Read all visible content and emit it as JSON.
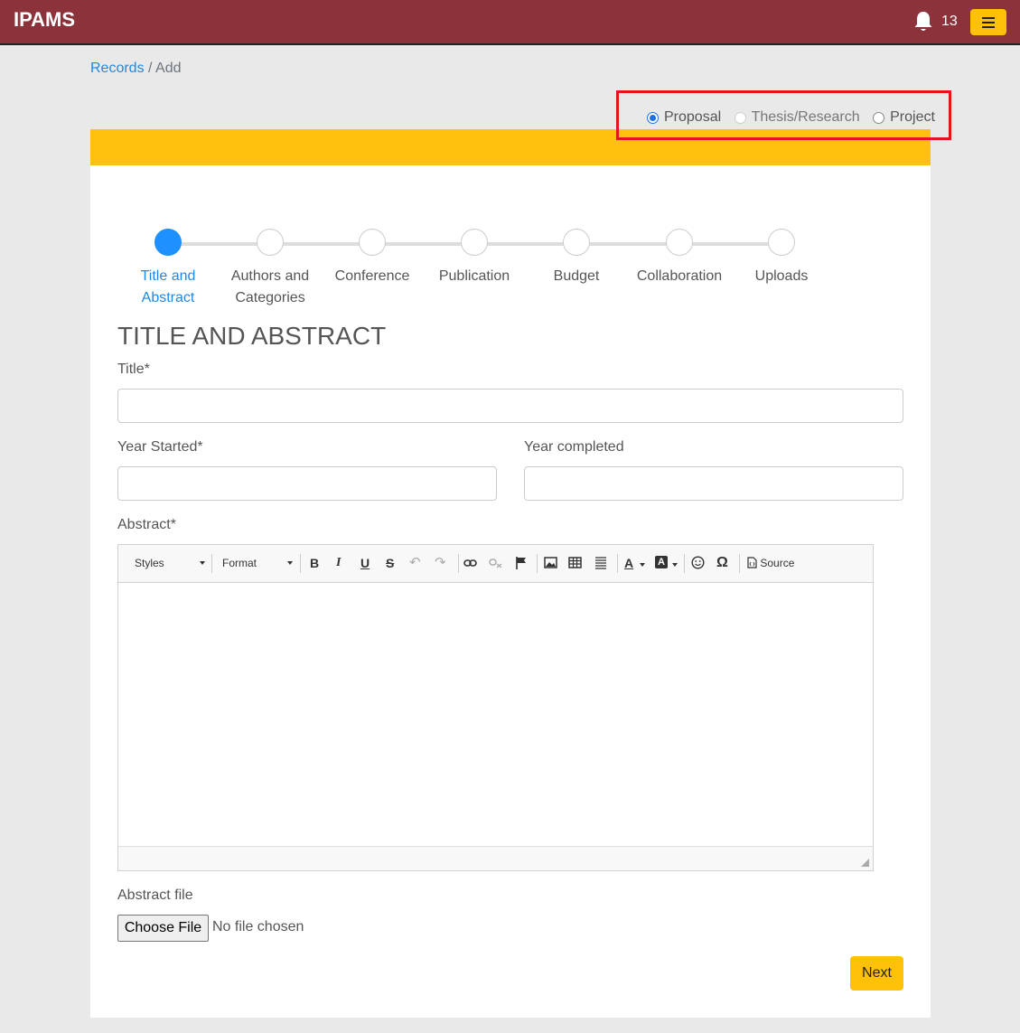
{
  "app": {
    "brand": "IPAMS",
    "notification_count": "13"
  },
  "breadcrumb": {
    "link": "Records",
    "separator": " / ",
    "current": "Add"
  },
  "record_types": [
    {
      "label": "Proposal",
      "state": "checked"
    },
    {
      "label": "Thesis/Research",
      "state": "disabled"
    },
    {
      "label": "Project",
      "state": "unchecked"
    }
  ],
  "steps": [
    {
      "line1": "Title and",
      "line2": "Abstract"
    },
    {
      "line1": "Authors and",
      "line2": "Categories"
    },
    {
      "line1": "Conference",
      "line2": ""
    },
    {
      "line1": "Publication",
      "line2": ""
    },
    {
      "line1": "Budget",
      "line2": ""
    },
    {
      "line1": "Collaboration",
      "line2": ""
    },
    {
      "line1": "Uploads",
      "line2": ""
    }
  ],
  "form": {
    "section_title": "TITLE AND ABSTRACT",
    "title_label": "Title*",
    "title_value": "",
    "year_started_label": "Year Started*",
    "year_started_value": "",
    "year_completed_label": "Year completed",
    "year_completed_value": "",
    "abstract_label": "Abstract*",
    "abstract_file_label": "Abstract file",
    "choose_file_label": "Choose File",
    "no_file_text": "No file chosen",
    "next_label": "Next"
  },
  "editor": {
    "styles_label": "Styles",
    "format_label": "Format",
    "source_label": "Source",
    "tools": [
      "bold-icon",
      "italic-icon",
      "underline-icon",
      "strikethrough-icon",
      "undo-icon",
      "redo-icon",
      "link-icon",
      "unlink-icon",
      "anchor-icon",
      "image-icon",
      "table-icon",
      "horizontal-line-icon",
      "text-color-icon",
      "background-color-icon",
      "smiley-icon",
      "special-char-icon",
      "source-icon"
    ]
  }
}
